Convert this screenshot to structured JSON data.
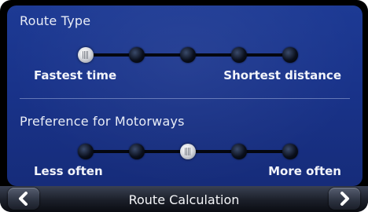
{
  "route_type": {
    "title": "Route Type",
    "stop_count": 5,
    "selected_index": 0,
    "min_label": "Fastest time",
    "max_label": "Shortest distance"
  },
  "motorways": {
    "title": "Preference for Motorways",
    "stop_count": 5,
    "selected_index": 2,
    "min_label": "Less often",
    "max_label": "More often"
  },
  "footer": {
    "title": "Route Calculation",
    "back_icon": "chevron-left-icon",
    "next_icon": "chevron-right-icon"
  }
}
